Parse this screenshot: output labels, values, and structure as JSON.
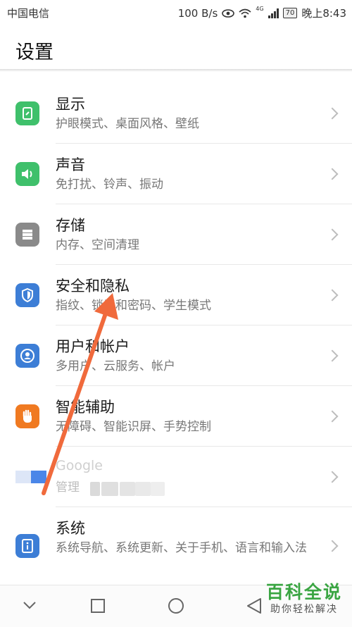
{
  "status_bar": {
    "carrier": "中国电信",
    "speed": "100 B/s",
    "network": "4G",
    "battery": "70",
    "time": "晚上8:43"
  },
  "header": {
    "title": "设置"
  },
  "settings": [
    {
      "label": "显示",
      "sub": "护眼模式、桌面风格、壁纸",
      "icon": "display-icon",
      "color": "#3fc06b"
    },
    {
      "label": "声音",
      "sub": "免打扰、铃声、振动",
      "icon": "speaker-icon",
      "color": "#3fc06b"
    },
    {
      "label": "存储",
      "sub": "内存、空间清理",
      "icon": "storage-icon",
      "color": "#8a8a8a"
    },
    {
      "label": "安全和隐私",
      "sub": "指纹、锁屏和密码、学生模式",
      "icon": "shield-icon",
      "color": "#3d7ed6"
    },
    {
      "label": "用户和帐户",
      "sub": "多用户、云服务、帐户",
      "icon": "user-icon",
      "color": "#3d7ed6"
    },
    {
      "label": "智能辅助",
      "sub": "无障碍、智能识屏、手势控制",
      "icon": "hand-icon",
      "color": "#f07a21"
    },
    {
      "label": "Google",
      "sub": "管理",
      "icon": "google-icon",
      "color": "#3d7ed6"
    },
    {
      "label": "系统",
      "sub": "系统导航、系统更新、关于手机、语言和输入法",
      "icon": "info-icon",
      "color": "#3d7ed6"
    }
  ],
  "watermark": {
    "title": "百科全说",
    "sub": "助你轻松解决"
  },
  "colors": {
    "arrow": "#f06a3c",
    "watermark_green": "#3aa542"
  }
}
